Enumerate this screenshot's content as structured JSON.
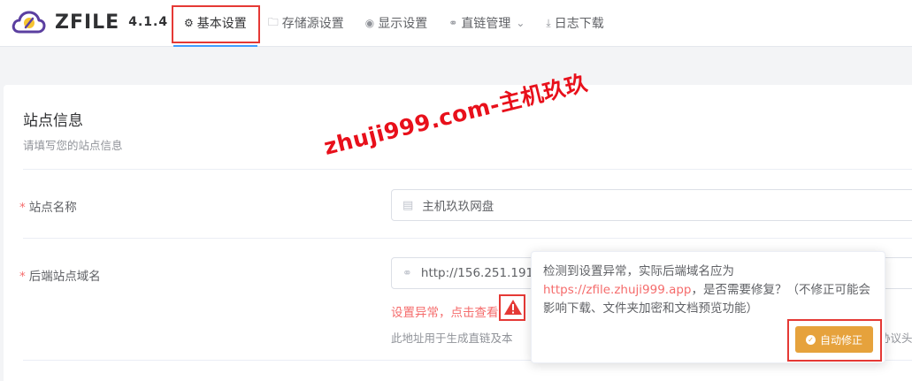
{
  "app": {
    "name": "ZFILE",
    "version": "4.1.4"
  },
  "nav": {
    "items": [
      {
        "label": "基本设置",
        "icon": "gear-icon",
        "active": true
      },
      {
        "label": "存储源设置",
        "icon": "folder-icon"
      },
      {
        "label": "显示设置",
        "icon": "eye-icon"
      },
      {
        "label": "直链管理",
        "icon": "link-icon",
        "dropdown_icon": "chevron-down-icon"
      },
      {
        "label": "日志下载",
        "icon": "download-icon"
      }
    ]
  },
  "section": {
    "title": "站点信息",
    "subtitle": "请填写您的站点信息"
  },
  "fields": {
    "site_name": {
      "required_mark": "*",
      "label": "站点名称",
      "value": "主机玖玖网盘",
      "icon": "document-icon"
    },
    "backend_domain": {
      "required_mark": "*",
      "label": "后端站点域名",
      "value": "http://156.251.191",
      "icon": "link-icon",
      "error_text": "设置异常，点击查看",
      "hint_text": "此地址用于生成直链及本",
      "hint_tail": "协议头"
    }
  },
  "popover": {
    "text_before": "检测到设置异常，实际后端域名应为 ",
    "link": "https://zfile.zhuji999.app",
    "text_after": "，是否需要修复？（不修正可能会影响下载、文件夹加密和文档预览功能）",
    "button_label": "自动修正"
  },
  "watermark": "zhuji999.com-主机玖玖",
  "colors": {
    "primary": "#409eff",
    "danger": "#f56c6c",
    "warning": "#e6a23c",
    "highlight": "#e53935"
  }
}
